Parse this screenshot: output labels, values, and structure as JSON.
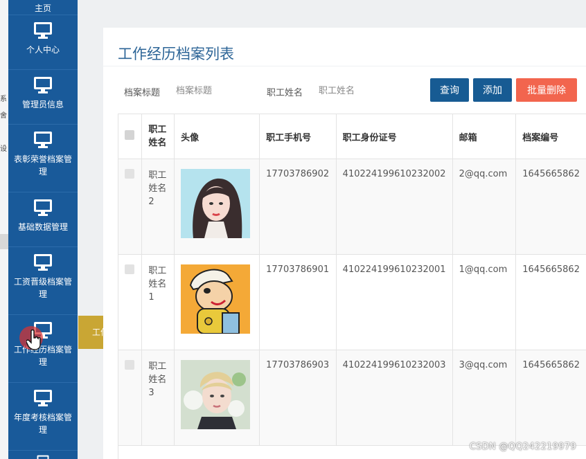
{
  "colors": {
    "sidebar": "#195a9a",
    "accent": "#175b93",
    "danger": "#f2654e",
    "flyout": "#c9a634"
  },
  "edge": {
    "chars": [
      "系",
      "舍",
      "设"
    ]
  },
  "sidebar": {
    "top_partial_label": "主页",
    "items": [
      {
        "label": "个人中心",
        "icon": "monitor-icon"
      },
      {
        "label": "管理员信息",
        "icon": "monitor-icon"
      },
      {
        "label": "表彰荣誉档案管理",
        "icon": "monitor-icon"
      },
      {
        "label": "基础数据管理",
        "icon": "monitor-icon"
      },
      {
        "label": "工资晋级档案管理",
        "icon": "monitor-icon"
      },
      {
        "label": "工作经历档案管理",
        "icon": "monitor-icon"
      },
      {
        "label": "年度考核档案管理",
        "icon": "monitor-icon"
      }
    ]
  },
  "flyout": {
    "label": "工作经历档案管理"
  },
  "page": {
    "title": "工作经历档案列表"
  },
  "search": {
    "title_label": "档案标题",
    "title_placeholder": "档案标题",
    "name_label": "职工姓名",
    "name_placeholder": "职工姓名"
  },
  "buttons": {
    "query": "查询",
    "add": "添加",
    "batch_delete": "批量删除"
  },
  "table": {
    "headers": [
      "职工\n姓名",
      "头像",
      "职工手机号",
      "职工身份证号",
      "邮箱",
      "档案编号"
    ],
    "rows": [
      {
        "name": "职工\n姓名\n2",
        "phone": "17703786902",
        "id_number": "410224199610232002",
        "email": "2@qq.com",
        "archive_no": "1645665862",
        "avatar": "girl-portrait"
      },
      {
        "name": "职工\n姓名\n1",
        "phone": "17703786901",
        "id_number": "410224199610232001",
        "email": "1@qq.com",
        "archive_no": "1645665862",
        "avatar": "cartoon-boy"
      },
      {
        "name": "职工\n姓名\n3",
        "phone": "17703786903",
        "id_number": "410224199610232003",
        "email": "3@qq.com",
        "archive_no": "1645665862",
        "avatar": "boy-portrait"
      }
    ]
  },
  "watermark": "CSDN @QQ242219979"
}
